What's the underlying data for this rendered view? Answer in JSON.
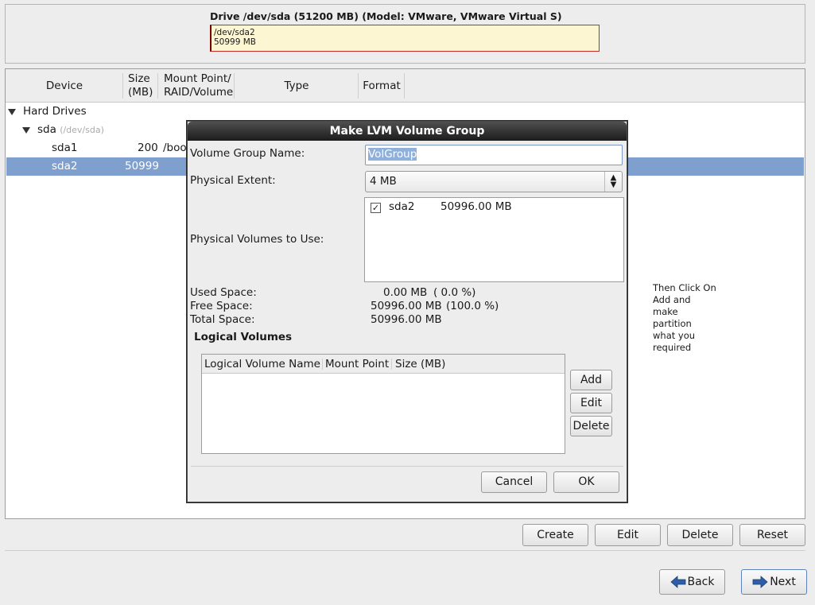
{
  "drive": {
    "title": "Drive /dev/sda (51200 MB) (Model: VMware, VMware Virtual S)",
    "bar_line1": "/dev/sda2",
    "bar_line2": "50999 MB"
  },
  "tree": {
    "headers": {
      "device": "Device",
      "size_1": "Size",
      "size_2": "(MB)",
      "mount_1": "Mount Point/",
      "mount_2": "RAID/Volume",
      "type": "Type",
      "format": "Format"
    },
    "hard_drives": "Hard Drives",
    "sda": {
      "label": "sda",
      "path": "(/dev/sda)"
    },
    "rows": [
      {
        "device": "sda1",
        "size": "200",
        "mount": "/boo"
      },
      {
        "device": "sda2",
        "size": "50999",
        "mount": ""
      }
    ]
  },
  "note": "Then Click On Add and make partition what you required",
  "buttons": {
    "create": "Create",
    "edit": "Edit",
    "delete": "Delete",
    "reset": "Reset",
    "back": "Back",
    "next": "Next"
  },
  "dialog": {
    "title": "Make LVM Volume Group",
    "vg_name_label": "Volume Group Name:",
    "vg_name_value": "VolGroup",
    "pe_label": "Physical Extent:",
    "pe_value": "4 MB",
    "pv_label": "Physical Volumes to Use:",
    "pv": {
      "name": "sda2",
      "size": "50996.00 MB",
      "checked": true
    },
    "used_label": "Used Space:",
    "used_value": "0.00 MB",
    "used_pct": "( 0.0 %)",
    "free_label": "Free Space:",
    "free_value": "50996.00 MB",
    "free_pct": "(100.0 %)",
    "total_label": "Total Space:",
    "total_value": "50996.00 MB",
    "lv_heading": "Logical Volumes",
    "lv_headers": {
      "name": "Logical Volume Name",
      "mount": "Mount Point",
      "size": "Size (MB)"
    },
    "lv_add": "Add",
    "lv_edit": "Edit",
    "lv_delete": "Delete",
    "cancel": "Cancel",
    "ok": "OK"
  }
}
